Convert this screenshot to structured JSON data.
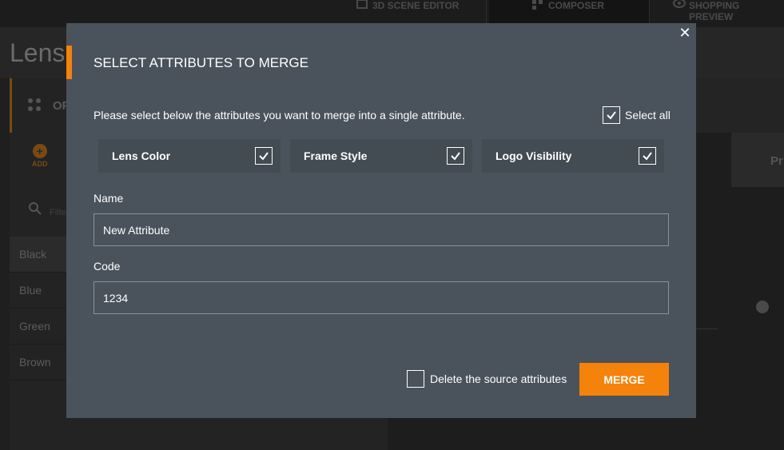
{
  "background": {
    "top_tabs": [
      {
        "label": "3D SCENE EDITOR",
        "icon": "cube-icon"
      },
      {
        "label": "COMPOSER",
        "icon": "composer-icon"
      },
      {
        "label": "SHOPPING PREVIEW",
        "icon": "eye-icon"
      }
    ],
    "page_title": "Lens",
    "panel_header": "OP",
    "add_label": "ADD",
    "search_placeholder": "Filte",
    "values": [
      "Black",
      "Blue",
      "Green",
      "Brown"
    ],
    "right_card_text": "Pr"
  },
  "modal": {
    "title": "SELECT ATTRIBUTES TO MERGE",
    "close_icon": "close-icon",
    "instructions": "Please select below the attributes you want to merge into a single attribute.",
    "select_all": {
      "label": "Select all",
      "checked": true
    },
    "attributes": [
      {
        "label": "Lens Color",
        "checked": true
      },
      {
        "label": "Frame Style",
        "checked": true
      },
      {
        "label": "Logo Visibility",
        "checked": true
      }
    ],
    "name_field": {
      "label": "Name",
      "value": "New Attribute"
    },
    "code_field": {
      "label": "Code",
      "value": "1234"
    },
    "delete_source": {
      "label": "Delete the source attributes",
      "checked": false
    },
    "merge_label": "MERGE"
  },
  "colors": {
    "accent": "#f5820b",
    "modal_bg": "#4a535c",
    "card_bg": "#434b53"
  }
}
